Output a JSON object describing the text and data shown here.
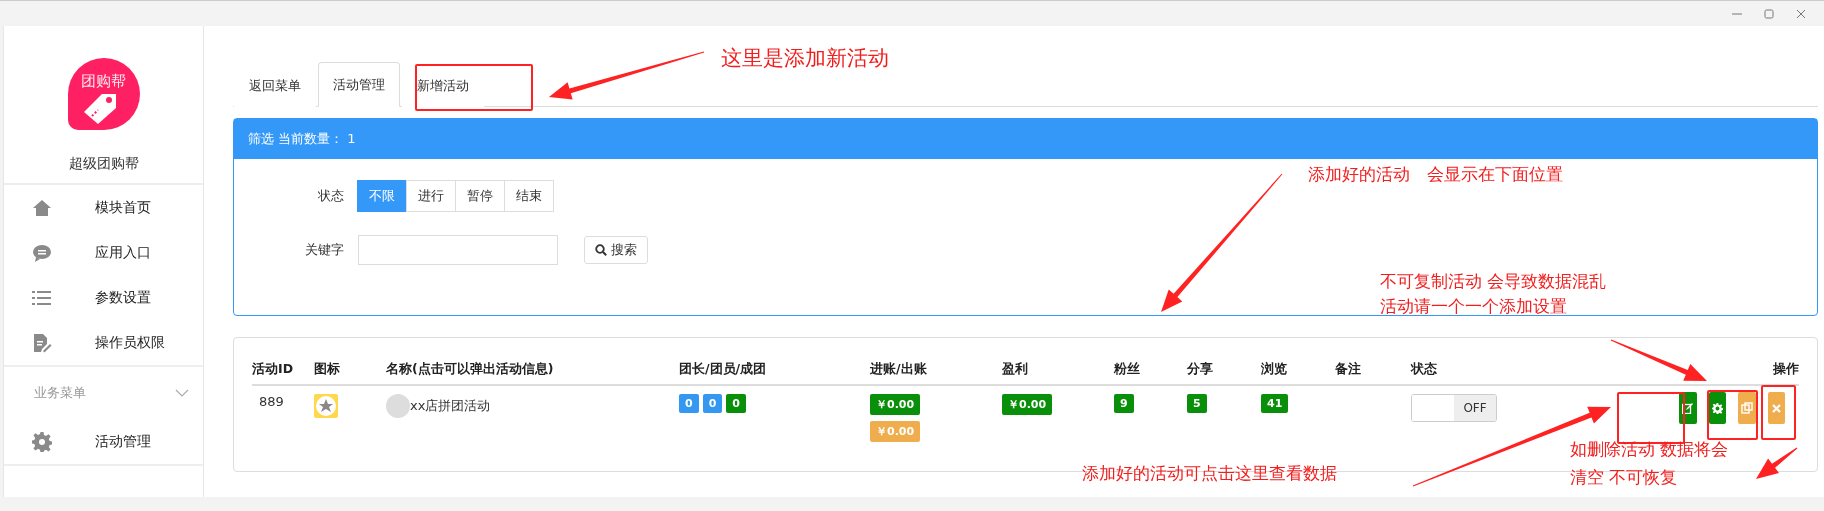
{
  "sidebar": {
    "logo_text": "团购帮",
    "app_name": "超级团购帮",
    "items": [
      {
        "kind": "home",
        "label": "模块首页"
      },
      {
        "kind": "chat",
        "label": "应用入口"
      },
      {
        "kind": "list",
        "label": "参数设置"
      },
      {
        "kind": "doc",
        "label": "操作员权限"
      }
    ],
    "section": {
      "label": "业务菜单",
      "expanded": true,
      "items": [
        {
          "kind": "gear",
          "label": "活动管理"
        }
      ]
    }
  },
  "tabs": [
    {
      "label": "返回菜单",
      "selected": false
    },
    {
      "label": "活动管理",
      "selected": true
    },
    {
      "label": "新增活动",
      "selected": false
    }
  ],
  "filter": {
    "title": "筛选 当前数量： 1",
    "status_label": "状态",
    "status_options": [
      {
        "label": "不限",
        "selected": true
      },
      {
        "label": "进行",
        "selected": false
      },
      {
        "label": "暂停",
        "selected": false
      },
      {
        "label": "结束",
        "selected": false
      }
    ],
    "keyword_label": "关键字",
    "search_button": "搜索"
  },
  "table": {
    "columns": [
      "活动ID",
      "图标",
      "名称(点击可以弹出活动信息)",
      "团长/团员/成团",
      "进账/出账",
      "盈利",
      "粉丝",
      "分享",
      "浏览",
      "备注",
      "状态",
      "操作"
    ],
    "rows": [
      {
        "id": "889",
        "name": "xx店拼团活动",
        "group_counts": [
          {
            "text": "0",
            "color": "#3498f0"
          },
          {
            "text": "0",
            "color": "#3498f0"
          },
          {
            "text": "0",
            "color": "#0a8f0a"
          }
        ],
        "money": [
          {
            "text": "￥0.00",
            "color": "#0a8f0a"
          },
          {
            "text": "￥0.00",
            "color": "#f0ad4e"
          }
        ],
        "profit": "￥0.00",
        "fans": "9",
        "shares": "5",
        "views": "41",
        "status": {
          "on": false,
          "label": "OFF"
        },
        "actions": [
          {
            "kind": "edit",
            "color": "#0a8f0a"
          },
          {
            "kind": "settings",
            "color": "#0a8f0a"
          },
          {
            "kind": "copy",
            "color": "#f0ad4e"
          },
          {
            "kind": "delete",
            "color": "#f0ad4e"
          }
        ]
      }
    ]
  },
  "annotations": [
    "这里是添加新活动",
    "添加好的活动　会显示在下面位置",
    "不可复制活动  会导致数据混乱",
    "活动请一个一个添加设置",
    "添加好的活动可点击这里查看数据",
    "如删除活动 数据将会",
    "清空  不可恢复"
  ]
}
